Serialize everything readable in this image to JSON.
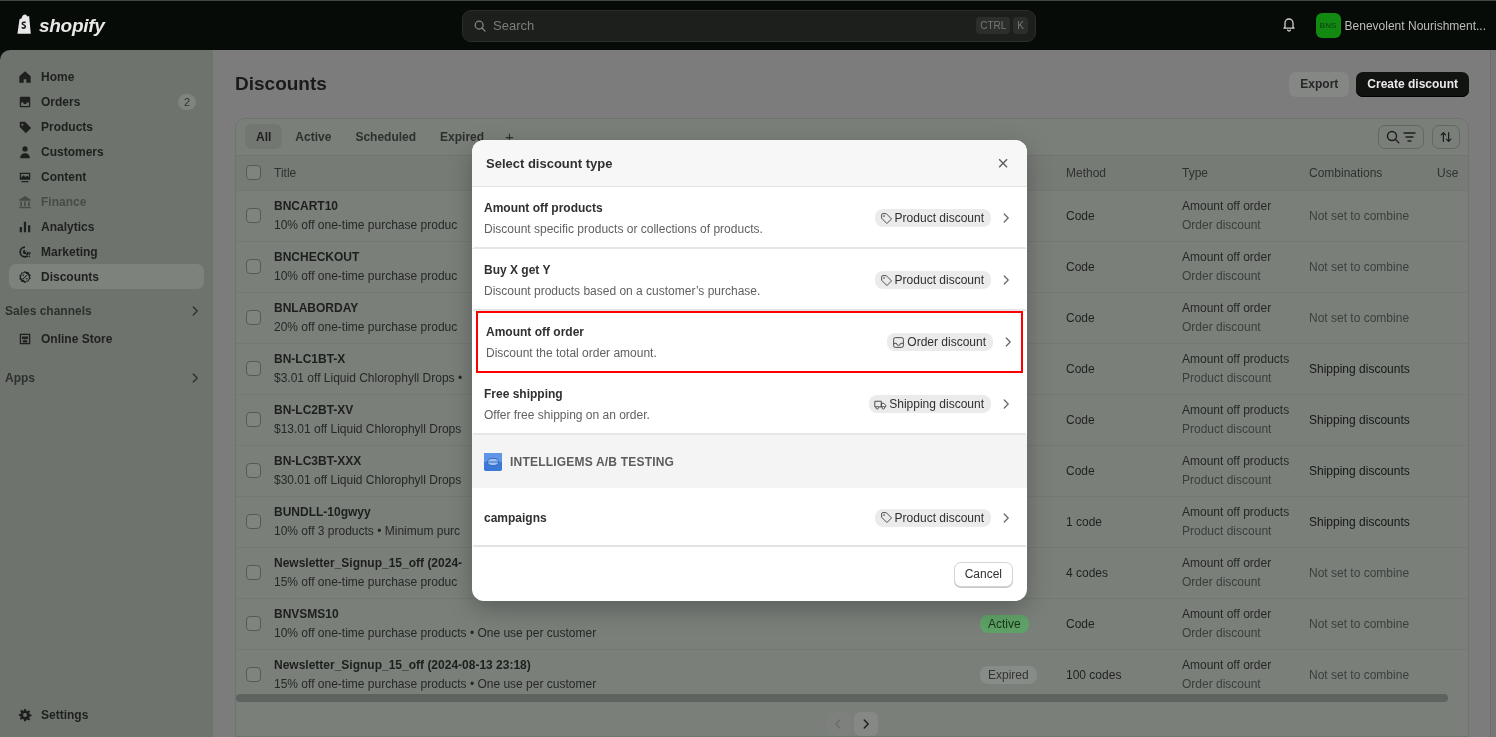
{
  "topbar": {
    "logo": "shopify",
    "search": {
      "placeholder": "Search",
      "keys": [
        "CTRL",
        "K"
      ]
    },
    "store": {
      "initials": "BNS",
      "name": "Benevolent Nourishment..."
    }
  },
  "sidebar": {
    "items": [
      {
        "label": "Home",
        "selected": false,
        "disabled": false
      },
      {
        "label": "Orders",
        "selected": false,
        "disabled": false,
        "badge": "2"
      },
      {
        "label": "Products",
        "selected": false,
        "disabled": false
      },
      {
        "label": "Customers",
        "selected": false,
        "disabled": false
      },
      {
        "label": "Content",
        "selected": false,
        "disabled": false
      },
      {
        "label": "Finance",
        "selected": false,
        "disabled": true
      },
      {
        "label": "Analytics",
        "selected": false,
        "disabled": false
      },
      {
        "label": "Marketing",
        "selected": false,
        "disabled": false
      },
      {
        "label": "Discounts",
        "selected": true,
        "disabled": false
      }
    ],
    "sections": [
      {
        "label": "Sales channels",
        "items": [
          {
            "label": "Online Store"
          }
        ]
      },
      {
        "label": "Apps"
      }
    ],
    "settings": {
      "label": "Settings"
    }
  },
  "page": {
    "title": "Discounts",
    "buttons": [
      {
        "label": "Export",
        "kind": "secondary"
      },
      {
        "label": "Create discount",
        "kind": "primary"
      }
    ]
  },
  "table": {
    "tabs": [
      {
        "label": "All",
        "selected": true
      },
      {
        "label": "Active",
        "selected": false
      },
      {
        "label": "Scheduled",
        "selected": false
      },
      {
        "label": "Expired",
        "selected": false
      }
    ],
    "add_tab": "+",
    "all_checked": false,
    "columns": {
      "title": "Title",
      "method": "Method",
      "type": "Type",
      "combinations": "Combinations",
      "used": "Use"
    },
    "rows": [
      {
        "checked": false,
        "title": "BNCART10",
        "summary": "10% off one-time purchase produc",
        "method": "Code",
        "type": "Amount off order",
        "class": "Order discount",
        "combinations": "Not set to combine",
        "combines": false
      },
      {
        "checked": false,
        "title": "BNCHECKOUT",
        "summary": "10% off one-time purchase produc",
        "method": "Code",
        "type": "Amount off order",
        "class": "Order discount",
        "combinations": "Not set to combine",
        "combines": false
      },
      {
        "checked": false,
        "title": "BNLABORDAY",
        "summary": "20% off one-time purchase produc",
        "method": "Code",
        "type": "Amount off order",
        "class": "Order discount",
        "combinations": "Not set to combine",
        "combines": false
      },
      {
        "checked": false,
        "title": "BN-LC1BT-X",
        "summary": "$3.01 off Liquid Chlorophyll Drops •",
        "method": "Code",
        "type": "Amount off products",
        "class": "Product discount",
        "combinations": "Shipping discounts",
        "combines": true
      },
      {
        "checked": false,
        "title": "BN-LC2BT-XV",
        "summary": "$13.01 off Liquid Chlorophyll Drops",
        "method": "Code",
        "type": "Amount off products",
        "class": "Product discount",
        "combinations": "Shipping discounts",
        "combines": true
      },
      {
        "checked": false,
        "title": "BN-LC3BT-XXX",
        "summary": "$30.01 off Liquid Chlorophyll Drops",
        "method": "Code",
        "type": "Amount off products",
        "class": "Product discount",
        "combinations": "Shipping discounts",
        "combines": true
      },
      {
        "checked": false,
        "title": "BUNDLL-10gwyy",
        "summary": "10% off 3 products • Minimum purc",
        "method": "1 code",
        "type": "Amount off products",
        "class": "Product discount",
        "combinations": "Shipping discounts",
        "combines": true
      },
      {
        "checked": false,
        "title": "Newsletter_Signup_15_off (2024-",
        "summary": "15% off one-time purchase produc",
        "method": "4 codes",
        "type": "Amount off order",
        "class": "Order discount",
        "combinations": "Not set to combine",
        "combines": false
      },
      {
        "checked": false,
        "title": "BNVSMS10",
        "summary": "10% off one-time purchase products • One use per customer",
        "status": {
          "label": "Active",
          "kind": "active"
        },
        "method": "Code",
        "type": "Amount off order",
        "class": "Order discount",
        "combinations": "Not set to combine",
        "combines": false
      },
      {
        "checked": false,
        "title": "Newsletter_Signup_15_off (2024-08-13 23:18)",
        "summary": "15% off one-time purchase products • One use per customer",
        "status": {
          "label": "Expired",
          "kind": "expired"
        },
        "method": "100 codes",
        "type": "Amount off order",
        "class": "Order discount",
        "combinations": "Not set to combine",
        "combines": false
      }
    ]
  },
  "dialog": {
    "title": "Select discount type",
    "close": "×",
    "options": [
      {
        "title": "Amount off products",
        "description": "Discount specific products or collections of products.",
        "tag": {
          "label": "Product discount",
          "kind": "product"
        },
        "highlighted": false
      },
      {
        "title": "Buy X get Y",
        "description": "Discount products based on a customer’s purchase.",
        "tag": {
          "label": "Product discount",
          "kind": "product"
        },
        "highlighted": false
      },
      {
        "title": "Amount off order",
        "description": "Discount the total order amount.",
        "tag": {
          "label": "Order discount",
          "kind": "order"
        },
        "highlighted": true
      },
      {
        "title": "Free shipping",
        "description": "Offer free shipping on an order.",
        "tag": {
          "label": "Shipping discount",
          "kind": "shipping"
        },
        "highlighted": false
      }
    ],
    "app_section": {
      "title": "INTELLIGEMS A/B TESTING",
      "options": [
        {
          "title": "campaigns",
          "tag": {
            "label": "Product discount",
            "kind": "product"
          },
          "highlighted": false
        }
      ]
    },
    "cancel": "Cancel"
  }
}
